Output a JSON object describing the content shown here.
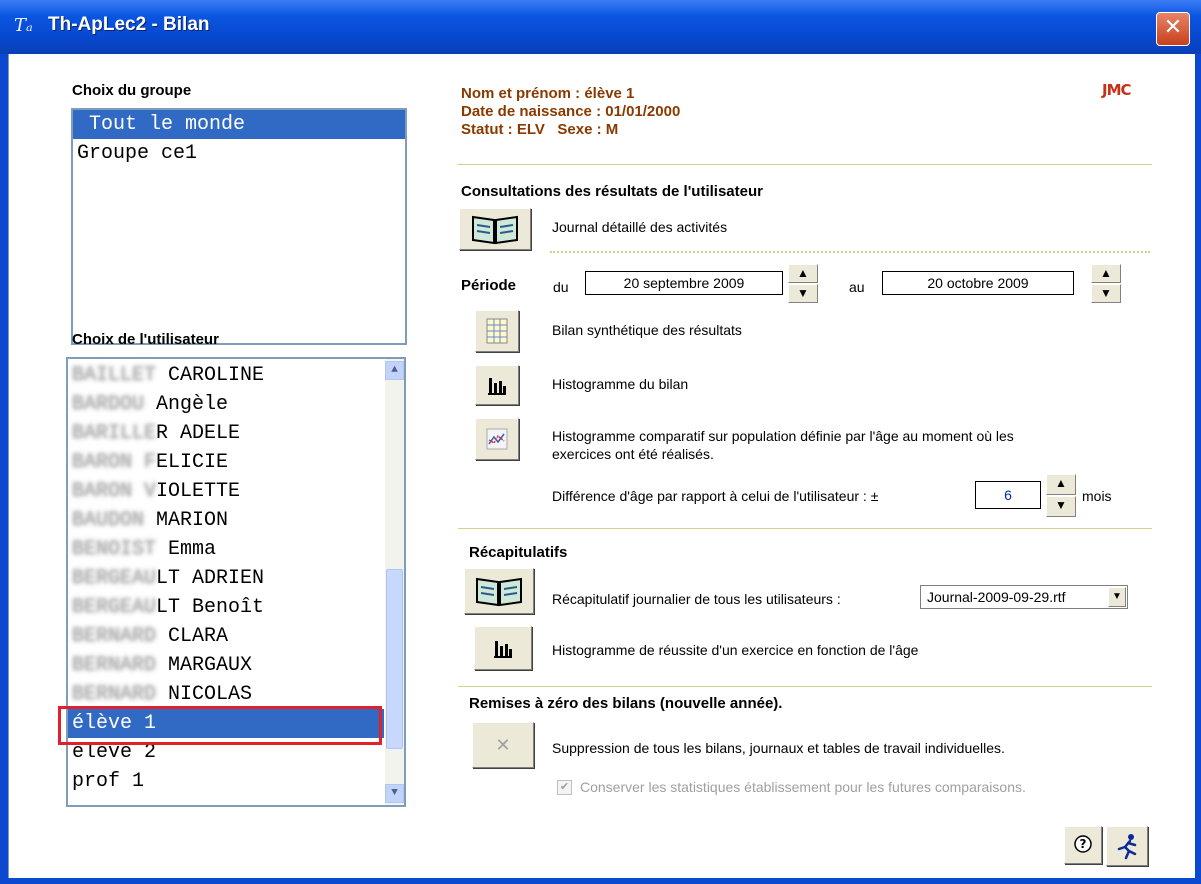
{
  "window": {
    "title": "Th-ApLec2 - Bilan",
    "close_glyph": "✕"
  },
  "group": {
    "label": "Choix du groupe",
    "items": [
      {
        "text": " Tout le monde",
        "selected": true
      },
      {
        "text": "Groupe ce1",
        "selected": false
      }
    ]
  },
  "user": {
    "label": "Choix de l'utilisateur",
    "items": [
      {
        "blur": "BAILLET",
        "text": " CAROLINE"
      },
      {
        "blur": "BARDOU",
        "text": " Angèle"
      },
      {
        "blur": "BARILLE",
        "text": "R ADELE"
      },
      {
        "blur": "BARON F",
        "text": "ELICIE"
      },
      {
        "blur": "BARON V",
        "text": "IOLETTE"
      },
      {
        "blur": "BAUDON",
        "text": " MARION"
      },
      {
        "blur": "BENOIST",
        "text": " Emma"
      },
      {
        "blur": "BERGEAU",
        "text": "LT ADRIEN"
      },
      {
        "blur": "BERGEAU",
        "text": "LT Benoît"
      },
      {
        "blur": "BERNARD",
        "text": " CLARA"
      },
      {
        "blur": "BERNARD",
        "text": " MARGAUX"
      },
      {
        "blur": "BERNARD",
        "text": " NICOLAS"
      },
      {
        "blur": "",
        "text": "élève 1",
        "selected": true
      },
      {
        "blur": "",
        "text": "élève 2"
      },
      {
        "blur": "",
        "text": "prof 1"
      }
    ]
  },
  "info": {
    "name": "Nom et prénom : élève 1",
    "birth": "Date de naissance : 01/01/2000",
    "status": "Statut : ELV   Sexe : M",
    "logo": "JMC"
  },
  "consult": {
    "title": "Consultations des résultats de l'utilisateur",
    "journal_label": "Journal détaillé des activités",
    "periode_label": "Période",
    "du_label": "du",
    "du_value": "20 septembre 2009",
    "au_label": "au",
    "au_value": "20 octobre 2009",
    "bilan_label": "Bilan synthétique des résultats",
    "histo_label": "Histogramme du bilan",
    "histo_comp_label_1": "Histogramme comparatif sur population définie par l'âge au moment où les",
    "histo_comp_label_2": "exercices ont été réalisés.",
    "age_diff_label": "Différence d'âge par rapport à celui de l'utilisateur : ±",
    "age_diff_value": "6",
    "mois_label": "mois"
  },
  "recap": {
    "title": "Récapitulatifs",
    "journal_label": "Récapitulatif journalier de tous les utilisateurs :",
    "journal_select": "Journal-2009-09-29.rtf",
    "histo_label": "Histogramme de réussite d'un exercice en fonction de l'âge"
  },
  "reset": {
    "title": "Remises à zéro des bilans (nouvelle année).",
    "suppr_label": "Suppression de tous les bilans, journaux et tables de travail individuelles.",
    "keep_stats_label": "Conserver les statistiques établissement pour les futures comparaisons."
  },
  "colors": {
    "titlebar": "#0a55e0",
    "selection": "#316ac5",
    "info_text": "#8a3a00",
    "highlight_box": "#e0202a"
  }
}
